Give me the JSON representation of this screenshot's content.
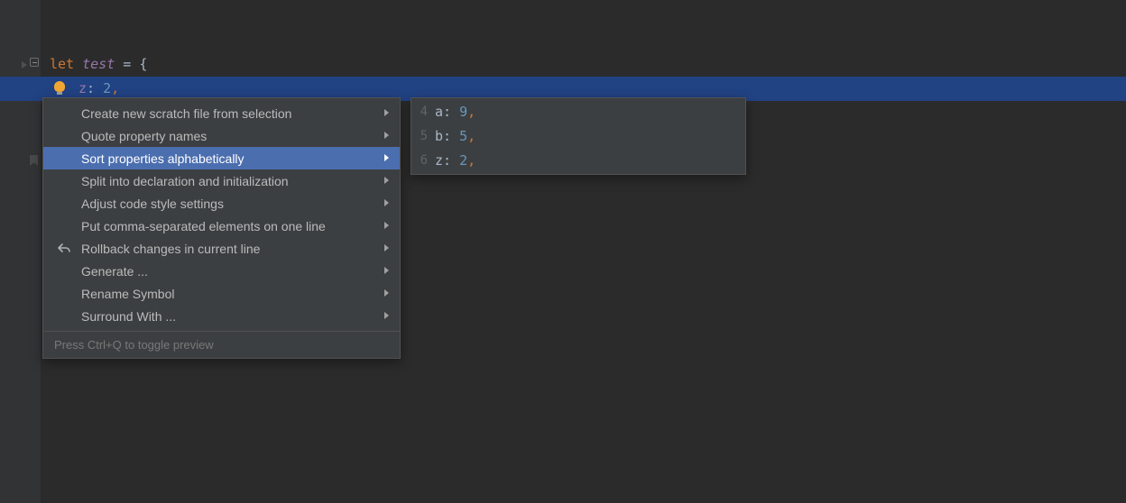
{
  "editor": {
    "line1": {
      "keyword": "let",
      "identifier": "test",
      "rest": " = {"
    },
    "line2": {
      "prop": "z",
      "colon": ":",
      "value": "2",
      "comma": ","
    }
  },
  "menu": {
    "items": [
      "Create new scratch file from selection",
      "Quote property names",
      "Sort properties alphabetically",
      "Split into declaration and initialization",
      "Adjust code style settings",
      "Put comma-separated elements on one line",
      "Rollback changes in current line",
      "Generate ...",
      "Rename Symbol",
      "Surround With ..."
    ],
    "selected_index": 2,
    "footer": "Press Ctrl+Q to toggle preview"
  },
  "preview": {
    "lines": [
      {
        "ln": "4",
        "prop": "a",
        "val": "9"
      },
      {
        "ln": "5",
        "prop": "b",
        "val": "5"
      },
      {
        "ln": "6",
        "prop": "z",
        "val": "2"
      }
    ]
  }
}
